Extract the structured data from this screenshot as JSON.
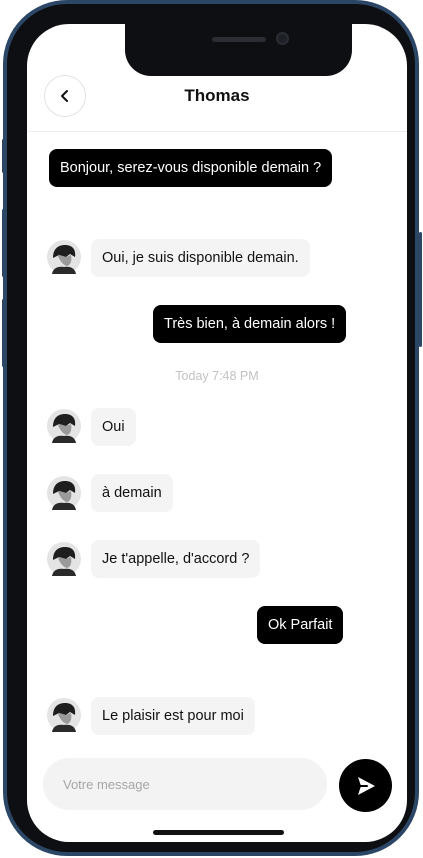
{
  "header": {
    "title": "Thomas",
    "back_icon": "chevron-left-icon"
  },
  "messages": [
    {
      "from": "me",
      "text": "Bonjour, serez-vous disponible demain ?"
    },
    {
      "from": "contact",
      "text": "Oui, je suis disponible demain."
    },
    {
      "from": "me",
      "text": "Très bien, à demain alors !"
    },
    {
      "from": "contact",
      "text": "Oui"
    },
    {
      "from": "contact",
      "text": "à demain"
    },
    {
      "from": "contact",
      "text": "Je t'appelle, d'accord ?"
    },
    {
      "from": "me",
      "text": "Ok Parfait"
    },
    {
      "from": "contact",
      "text": "Le plaisir est pour moi"
    }
  ],
  "timestamp": "Today 7:48 PM",
  "composer": {
    "placeholder": "Votre message",
    "value": "",
    "send_icon": "send-icon"
  },
  "colors": {
    "sent_bubble": "#000000",
    "received_bubble": "#f4f4f4",
    "frame": "#2c4666",
    "timestamp": "#c2c2c2"
  }
}
